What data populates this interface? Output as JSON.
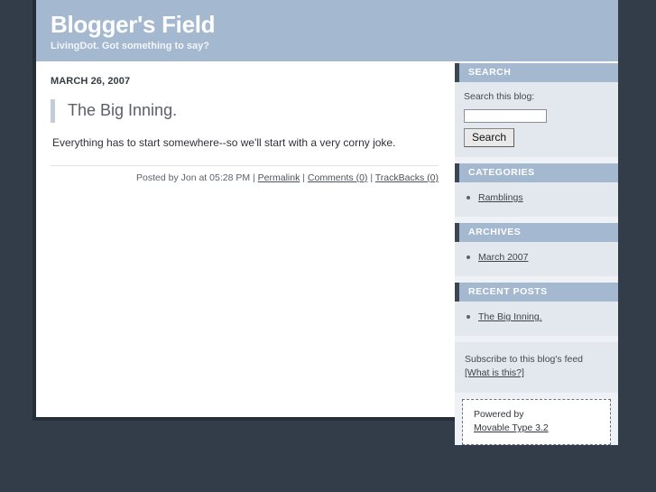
{
  "banner": {
    "title": "Blogger's Field",
    "tagline": "LivingDot. Got something to say?"
  },
  "colors": {
    "page_background": "#333d4a",
    "banner_background": "#a4b8d0",
    "module_header_background": "#a4b8d0",
    "module_header_accent": "#3a4654",
    "module_body_background": "#e3e8ee",
    "sidebar_background": "#eef1f5",
    "content_background": "#ffffff",
    "post_title_accent": "#c3ccd8"
  },
  "post": {
    "date_header": "MARCH 26, 2007",
    "title": "The Big Inning.",
    "body": "Everything has to start somewhere--so we'll start with a very corny joke.",
    "footer": {
      "byline": "Posted by Jon at 05:28 PM",
      "separator": " | ",
      "permalink_label": "Permalink",
      "comments_label": "Comments (0)",
      "trackbacks_label": "TrackBacks (0)"
    }
  },
  "sidebar": {
    "search": {
      "heading": "SEARCH",
      "label": "Search this blog:",
      "input_value": "",
      "input_placeholder": "",
      "button_label": "Search"
    },
    "categories": {
      "heading": "CATEGORIES",
      "items": [
        {
          "label": "Ramblings"
        }
      ]
    },
    "archives": {
      "heading": "ARCHIVES",
      "items": [
        {
          "label": "March 2007"
        }
      ]
    },
    "recent_posts": {
      "heading": "RECENT POSTS",
      "items": [
        {
          "label": "The Big Inning."
        }
      ]
    },
    "syndicate": {
      "text": "Subscribe to this blog's feed",
      "help_link": "[What is this?]"
    },
    "powered_by": {
      "text": "Powered by",
      "link": "Movable Type 3.2"
    }
  }
}
